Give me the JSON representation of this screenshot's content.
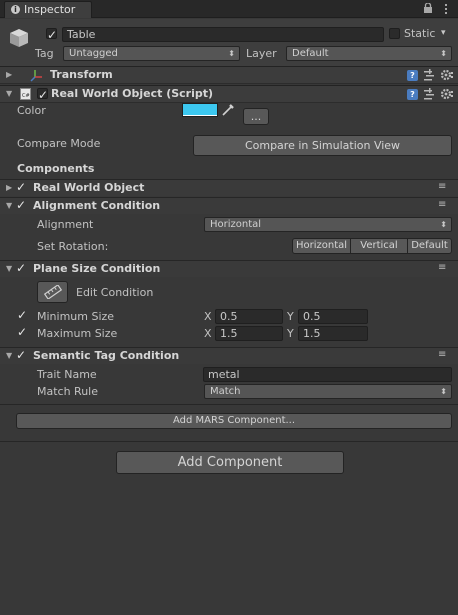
{
  "window": {
    "tab_title": "Inspector"
  },
  "header": {
    "object_name": "Table",
    "static_label": "Static",
    "tag_label": "Tag",
    "tag_value": "Untagged",
    "layer_label": "Layer",
    "layer_value": "Default"
  },
  "transform": {
    "title": "Transform"
  },
  "real_world_object_script": {
    "title": "Real World Object (Script)",
    "color_label": "Color",
    "color_value": "#3cc8f0",
    "picker_button": "...",
    "compare_mode_label": "Compare Mode",
    "compare_button": "Compare in Simulation View",
    "components_heading": "Components"
  },
  "real_world_object": {
    "title": "Real World Object"
  },
  "alignment_condition": {
    "title": "Alignment Condition",
    "alignment_label": "Alignment",
    "alignment_value": "Horizontal",
    "set_rotation_label": "Set Rotation:",
    "rotation_buttons": [
      "Horizontal",
      "Vertical",
      "Default"
    ]
  },
  "plane_size_condition": {
    "title": "Plane Size Condition",
    "edit_condition": "Edit Condition",
    "minimum_label": "Minimum Size",
    "minimum_x": "0.5",
    "minimum_y": "0.5",
    "maximum_label": "Maximum Size",
    "maximum_x": "1.5",
    "maximum_y": "1.5",
    "x_label": "X",
    "y_label": "Y"
  },
  "semantic_tag_condition": {
    "title": "Semantic Tag Condition",
    "trait_name_label": "Trait Name",
    "trait_name_value": "metal",
    "match_rule_label": "Match Rule",
    "match_rule_value": "Match"
  },
  "add_mars_button": "Add MARS Component...",
  "add_component_button": "Add Component",
  "check_glyph": "✓",
  "dropdown_glyph": "▾",
  "menu_glyph": "≡",
  "help_glyph": "?",
  "more_glyph": "⋮"
}
